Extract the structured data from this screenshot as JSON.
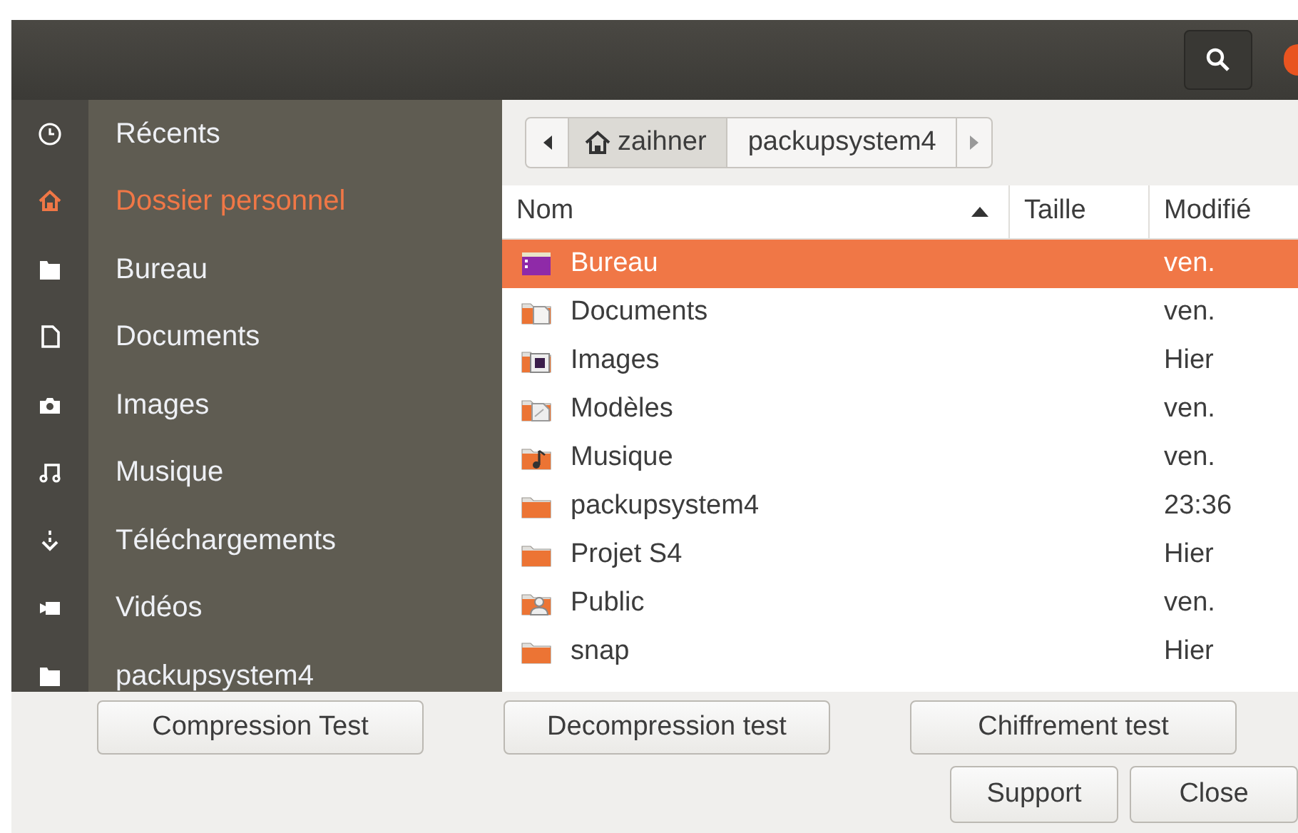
{
  "sidebar": {
    "items": [
      {
        "kind": "recent",
        "label": "Récents",
        "selected": false
      },
      {
        "kind": "home",
        "label": "Dossier personnel",
        "selected": true
      },
      {
        "kind": "folder",
        "label": "Bureau",
        "selected": false
      },
      {
        "kind": "document",
        "label": "Documents",
        "selected": false
      },
      {
        "kind": "camera",
        "label": "Images",
        "selected": false
      },
      {
        "kind": "music",
        "label": "Musique",
        "selected": false
      },
      {
        "kind": "download",
        "label": "Téléchargements",
        "selected": false
      },
      {
        "kind": "video",
        "label": "Vidéos",
        "selected": false
      },
      {
        "kind": "folder",
        "label": "packupsystem4",
        "selected": false
      }
    ]
  },
  "path_bar": {
    "segments": [
      {
        "label": "zaihner",
        "home": true,
        "selected": true
      },
      {
        "label": "packupsystem4",
        "home": false,
        "selected": false
      }
    ]
  },
  "table": {
    "columns": [
      "Nom",
      "Taille",
      "Modifié"
    ],
    "rows": [
      {
        "kind": "desktop",
        "name": "Bureau",
        "modified": "ven.",
        "selected": true
      },
      {
        "kind": "documents",
        "name": "Documents",
        "modified": "ven.",
        "selected": false
      },
      {
        "kind": "pictures",
        "name": "Images",
        "modified": "Hier",
        "selected": false
      },
      {
        "kind": "templates",
        "name": "Modèles",
        "modified": "ven.",
        "selected": false
      },
      {
        "kind": "music",
        "name": "Musique",
        "modified": "ven.",
        "selected": false
      },
      {
        "kind": "folder",
        "name": "packupsystem4",
        "modified": "23:36",
        "selected": false
      },
      {
        "kind": "folder",
        "name": "Projet S4",
        "modified": "Hier",
        "selected": false
      },
      {
        "kind": "public",
        "name": "Public",
        "modified": "ven.",
        "selected": false
      },
      {
        "kind": "folder",
        "name": "snap",
        "modified": "Hier",
        "selected": false
      }
    ]
  },
  "buttons": [
    [
      "Compression Test",
      "Decompression test",
      "Chiffrement test"
    ],
    [
      "Support",
      "Close"
    ]
  ]
}
